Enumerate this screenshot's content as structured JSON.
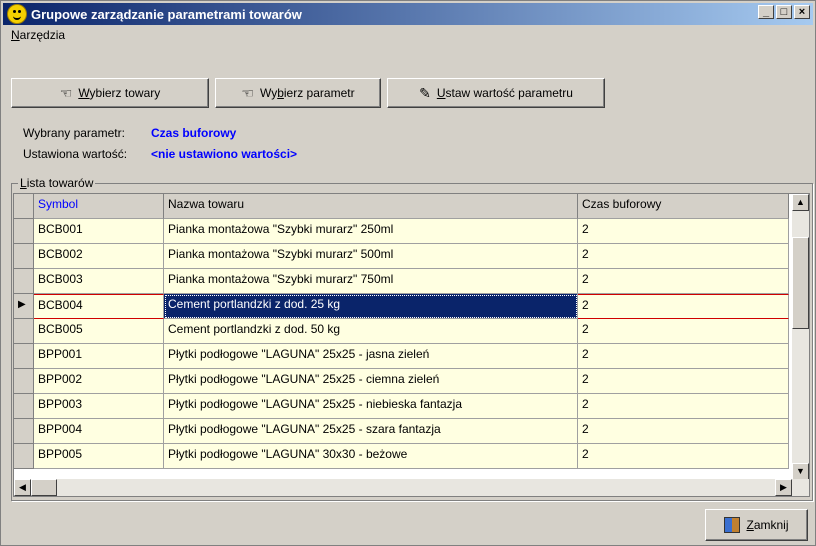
{
  "window": {
    "title": "Grupowe zarządzanie parametrami towarów"
  },
  "menu": {
    "items": [
      {
        "mnemonic": "N",
        "rest": "arzędzia"
      }
    ]
  },
  "toolbar": {
    "select_items": {
      "mnemonic": "W",
      "rest": "ybierz towary"
    },
    "select_param": {
      "pre": "Wy",
      "mnemonic": "b",
      "rest": "ierz parametr"
    },
    "set_value": {
      "mnemonic": "U",
      "rest": "staw wartość parametru"
    }
  },
  "info": {
    "param_label": "Wybrany parametr:",
    "param_value": "Czas buforowy",
    "value_label": "Ustawiona wartość:",
    "value_value": "<nie ustawiono wartości>"
  },
  "group": {
    "mnemonic": "L",
    "rest": "ista towarów"
  },
  "grid": {
    "columns": [
      "Symbol",
      "Nazwa towaru",
      "Czas buforowy"
    ],
    "current_index": 3,
    "rows": [
      [
        "BCB001",
        "Pianka montażowa \"Szybki murarz\" 250ml",
        "2"
      ],
      [
        "BCB002",
        "Pianka montażowa \"Szybki murarz\" 500ml",
        "2"
      ],
      [
        "BCB003",
        "Pianka montażowa \"Szybki murarz\" 750ml",
        "2"
      ],
      [
        "BCB004",
        "Cement portlandzki z dod. 25 kg",
        "2"
      ],
      [
        "BCB005",
        "Cement portlandzki z dod. 50 kg",
        "2"
      ],
      [
        "BPP001",
        "Płytki podłogowe \"LAGUNA\" 25x25 - jasna zieleń",
        "2"
      ],
      [
        "BPP002",
        "Płytki podłogowe \"LAGUNA\" 25x25 - ciemna zieleń",
        "2"
      ],
      [
        "BPP003",
        "Płytki podłogowe \"LAGUNA\" 25x25 - niebieska fantazja",
        "2"
      ],
      [
        "BPP004",
        "Płytki podłogowe \"LAGUNA\" 25x25 - szara fantazja",
        "2"
      ],
      [
        "BPP005",
        "Płytki podłogowe \"LAGUNA\" 30x30 - beżowe",
        "2"
      ]
    ]
  },
  "footer": {
    "close": {
      "mnemonic": "Z",
      "rest": "amknij"
    }
  },
  "colors": {
    "title_start": "#0a246a",
    "title_end": "#a6caf0",
    "row_bg": "#ffffe1",
    "selection": "#0a246a",
    "accent": "#0000ff"
  }
}
